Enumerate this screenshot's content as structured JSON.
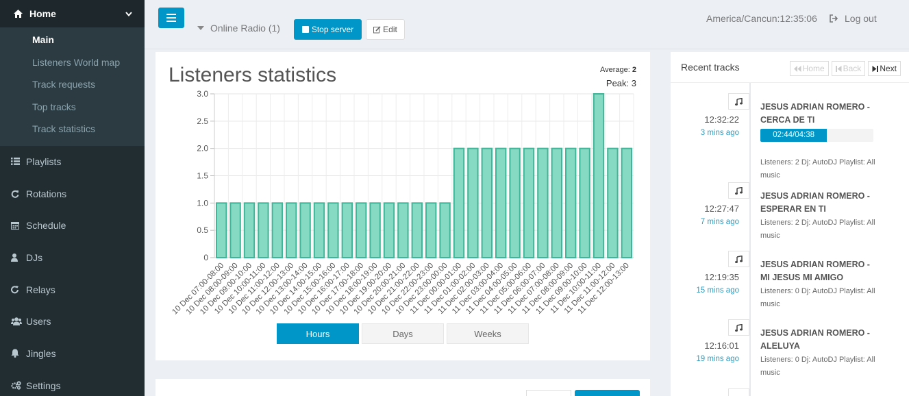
{
  "sidebar": {
    "home": {
      "label": "Home",
      "icon": "home-icon"
    },
    "submenu": [
      "Main",
      "Listeners World map",
      "Track requests",
      "Top tracks",
      "Track statistics"
    ],
    "items": [
      {
        "label": "Playlists",
        "icon": "list-icon"
      },
      {
        "label": "Rotations",
        "icon": "refresh-icon"
      },
      {
        "label": "Schedule",
        "icon": "calendar-icon"
      },
      {
        "label": "DJs",
        "icon": "user-icon"
      },
      {
        "label": "Relays",
        "icon": "repeat-icon"
      },
      {
        "label": "Users",
        "icon": "users-icon"
      },
      {
        "label": "Jingles",
        "icon": "bell-icon"
      },
      {
        "label": "Settings",
        "icon": "gears-icon"
      }
    ]
  },
  "topbar": {
    "station": "Online Radio (1)",
    "stop_label": "Stop server",
    "edit_label": "Edit",
    "timezone": "America/Cancun:12:35:06",
    "logout_label": "Log out"
  },
  "stats": {
    "title": "Listeners statistics",
    "average_label": "Average:",
    "average_value": "2",
    "peak": "Peak: 3",
    "ranges": [
      "Hours",
      "Days",
      "Weeks"
    ],
    "active_range": "Hours"
  },
  "chart_data": {
    "type": "bar",
    "categories": [
      "10 Dec 07:00-08:00",
      "10 Dec 08:00-09:00",
      "10 Dec 09:00-10:00",
      "10 Dec 10:00-11:00",
      "10 Dec 11:00-12:00",
      "10 Dec 12:00-13:00",
      "10 Dec 13:00-14:00",
      "10 Dec 14:00-15:00",
      "10 Dec 15:00-16:00",
      "10 Dec 16:00-17:00",
      "10 Dec 17:00-18:00",
      "10 Dec 18:00-19:00",
      "10 Dec 19:00-20:00",
      "10 Dec 20:00-21:00",
      "10 Dec 21:00-22:00",
      "10 Dec 22:00-23:00",
      "10 Dec 23:00-00:00",
      "11 Dec 00:00-01:00",
      "11 Dec 01:00-02:00",
      "11 Dec 02:00-03:00",
      "11 Dec 03:00-04:00",
      "11 Dec 04:00-05:00",
      "11 Dec 05:00-06:00",
      "11 Dec 06:00-07:00",
      "11 Dec 07:00-08:00",
      "11 Dec 08:00-09:00",
      "11 Dec 09:00-10:00",
      "11 Dec 10:00-11:00",
      "11 Dec 11:00-12:00",
      "11 Dec 12:00-13:00"
    ],
    "values": [
      1,
      1,
      1,
      1,
      1,
      1,
      1,
      1,
      1,
      1,
      1,
      1,
      1,
      1,
      1,
      1,
      1,
      2,
      2,
      2,
      2,
      2,
      2,
      2,
      2,
      2,
      2,
      3,
      2,
      2
    ],
    "yticks": [
      "0",
      "0.5",
      "1.0",
      "1.5",
      "2.0",
      "2.5",
      "3.0"
    ],
    "ylim": [
      0,
      3
    ],
    "grid": true,
    "bar_color": "#86d9c2",
    "bar_border": "#40b597"
  },
  "recent": {
    "title": "Recent tracks",
    "nav": [
      "Home",
      "Back",
      "Next"
    ],
    "tracks": [
      {
        "time": "12:32:22",
        "ago": "3 mins ago",
        "name": "JESUS ADRIAN ROMERO - CERCA DE TI",
        "progress_text": "02:44/04:38",
        "progress": 0.59,
        "meta": "Listeners: 2 Dj: AutoDJ Playlist: All music"
      },
      {
        "time": "12:27:47",
        "ago": "7 mins ago",
        "name": "JESUS ADRIAN ROMERO - ESPERAR EN TI",
        "meta": "Listeners: 2 Dj: AutoDJ Playlist: All music"
      },
      {
        "time": "12:19:35",
        "ago": "15 mins ago",
        "name": "JESUS ADRIAN ROMERO - MI JESUS MI AMIGO",
        "meta": "Listeners: 0 Dj: AutoDJ Playlist: All music"
      },
      {
        "time": "12:16:01",
        "ago": "19 mins ago",
        "name": "JESUS ADRIAN ROMERO - ALELUYA",
        "meta": "Listeners: 0 Dj: AutoDJ Playlist: All music"
      }
    ]
  },
  "colors": {
    "accent": "#0096c7",
    "sidebar": "#222d32"
  }
}
